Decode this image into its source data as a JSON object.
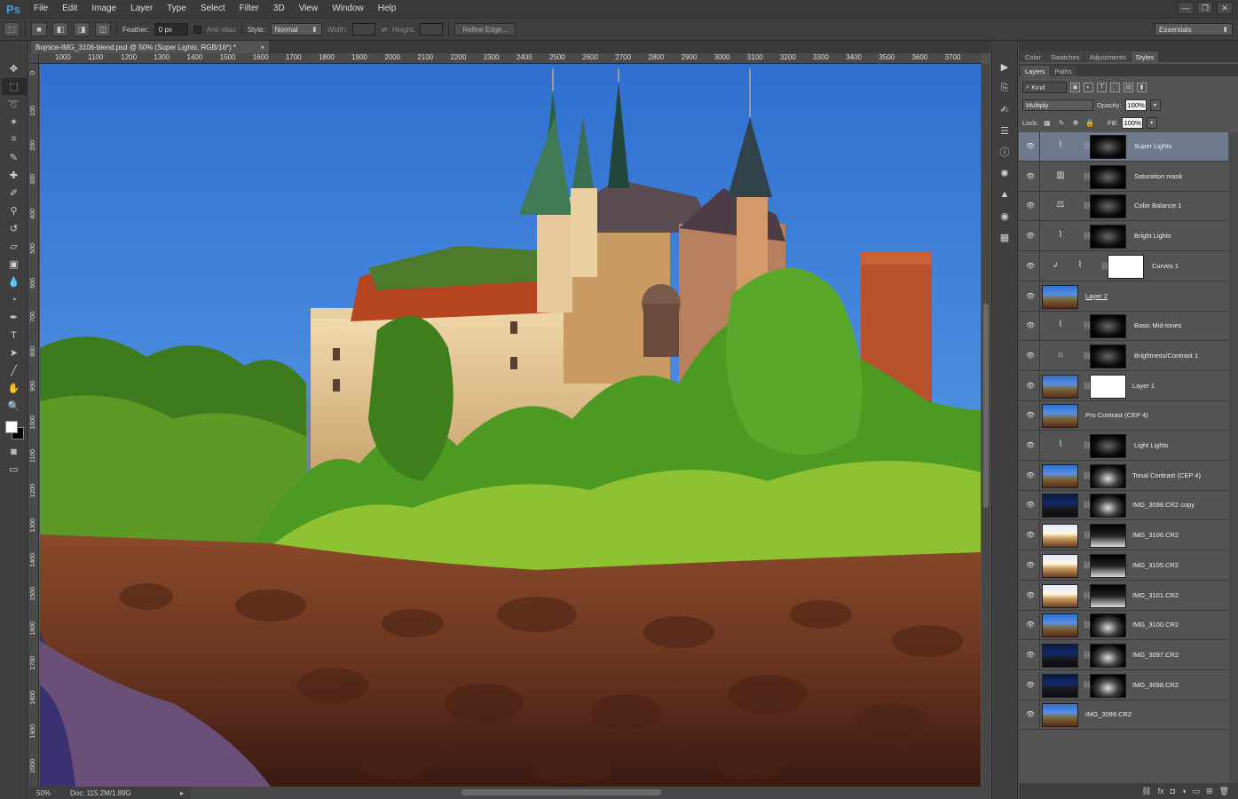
{
  "app": {
    "logo": "Ps"
  },
  "menu": [
    "File",
    "Edit",
    "Image",
    "Layer",
    "Type",
    "Select",
    "Filter",
    "3D",
    "View",
    "Window",
    "Help"
  ],
  "window_controls": {
    "minimize": "—",
    "restore": "❐",
    "close": "✕"
  },
  "options": {
    "feather_label": "Feather:",
    "feather_value": "0 px",
    "antialias_label": "Anti-alias",
    "style_label": "Style:",
    "style_value": "Normal",
    "width_label": "Width:",
    "height_label": "Height:",
    "refine_edge": "Refine Edge...",
    "workspace": "Essentials"
  },
  "document": {
    "tab_title": "Bojnice-IMG_3106-blend.psd @ 50% (Super Lights, RGB/16*) *",
    "close_glyph": "×",
    "zoom": "50%",
    "doc_info": "Doc: 115.2M/1.89G"
  },
  "ruler_top": [
    "1000",
    "1100",
    "1200",
    "1300",
    "1400",
    "1500",
    "1600",
    "1700",
    "1800",
    "1900",
    "2000",
    "2100",
    "2200",
    "2300",
    "2400",
    "2500",
    "2600",
    "2700",
    "2800",
    "2900",
    "3000",
    "3100",
    "3200",
    "3300",
    "3400",
    "3500",
    "3600",
    "3700"
  ],
  "ruler_left": [
    "0",
    "100",
    "200",
    "300",
    "400",
    "500",
    "600",
    "700",
    "800",
    "900",
    "1000",
    "1100",
    "1200",
    "1300",
    "1400",
    "1500",
    "1600",
    "1700",
    "1800",
    "1900",
    "2000"
  ],
  "panels": {
    "top_tabs": [
      "Color",
      "Swatches",
      "Adjustments",
      "Styles"
    ],
    "layer_tabs": [
      "Layers",
      "Paths"
    ],
    "kind_label": "Kind",
    "blend_mode": "Multiply",
    "opacity_label": "Opacity:",
    "opacity_value": "100%",
    "lock_label": "Lock:",
    "fill_label": "Fill:",
    "fill_value": "100%"
  },
  "layers": [
    {
      "name": "Super Lights",
      "type": "adjustment",
      "icon": "curves-icon",
      "selected": true
    },
    {
      "name": "Saturation mask",
      "type": "adjustment",
      "icon": "hue-sat-icon"
    },
    {
      "name": "Color Balance 1",
      "type": "adjustment",
      "icon": "balance-icon"
    },
    {
      "name": "Bright Lights",
      "type": "adjustment",
      "icon": "curves-icon"
    },
    {
      "name": "Curves 1",
      "type": "adjustment",
      "icon": "curves-icon",
      "clipped": true,
      "white_mask": true
    },
    {
      "name": "Layer 2",
      "type": "pixel"
    },
    {
      "name": "Basic Mid-tones",
      "type": "adjustment",
      "icon": "curves-icon"
    },
    {
      "name": "Brightness/Contrast 1",
      "type": "adjustment",
      "icon": "brightness-icon"
    },
    {
      "name": "Layer 1",
      "type": "pixel-mask",
      "white_mask": true
    },
    {
      "name": "Pro Contrast (CEP 4)",
      "type": "pixel"
    },
    {
      "name": "Light Lights",
      "type": "adjustment",
      "icon": "curves-icon"
    },
    {
      "name": "Tonal Contrast (CEP 4)",
      "type": "pixel-mask"
    },
    {
      "name": "IMG_3098.CR2 copy",
      "type": "pixel-mask",
      "dark": true
    },
    {
      "name": "IMG_3106.CR2",
      "type": "pixel-mask",
      "bright": true
    },
    {
      "name": "IMG_3105.CR2",
      "type": "pixel-mask",
      "bright": true
    },
    {
      "name": "IMG_3101.CR2",
      "type": "pixel-mask",
      "bright": true
    },
    {
      "name": "IMG_3100.CR2",
      "type": "pixel-mask"
    },
    {
      "name": "IMG_3097.CR2",
      "type": "pixel-mask",
      "dark": true
    },
    {
      "name": "IMG_3098.CR2",
      "type": "pixel-mask",
      "dark": true
    },
    {
      "name": "IMG_3099.CR2",
      "type": "pixel"
    }
  ],
  "colors": {
    "accent": "#4f9bd8",
    "selected_layer": "#6e7b8e",
    "panel_bg": "#535353"
  }
}
